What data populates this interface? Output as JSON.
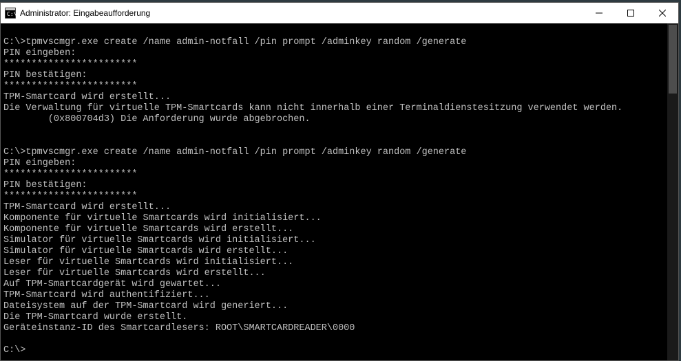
{
  "titlebar": {
    "title": "Administrator: Eingabeaufforderung"
  },
  "terminal": {
    "lines": [
      "",
      "C:\\>tpmvscmgr.exe create /name admin-notfall /pin prompt /adminkey random /generate",
      "PIN eingeben:",
      "************************",
      "PIN bestätigen:",
      "************************",
      "TPM-Smartcard wird erstellt...",
      "Die Verwaltung für virtuelle TPM-Smartcards kann nicht innerhalb einer Terminaldienstesitzung verwendet werden.",
      "        (0x800704d3) Die Anforderung wurde abgebrochen.",
      "",
      "",
      "C:\\>tpmvscmgr.exe create /name admin-notfall /pin prompt /adminkey random /generate",
      "PIN eingeben:",
      "************************",
      "PIN bestätigen:",
      "************************",
      "TPM-Smartcard wird erstellt...",
      "Komponente für virtuelle Smartcards wird initialisiert...",
      "Komponente für virtuelle Smartcards wird erstellt...",
      "Simulator für virtuelle Smartcards wird initialisiert...",
      "Simulator für virtuelle Smartcards wird erstellt...",
      "Leser für virtuelle Smartcards wird initialisiert...",
      "Leser für virtuelle Smartcards wird erstellt...",
      "Auf TPM-Smartcardgerät wird gewartet...",
      "TPM-Smartcard wird authentifiziert...",
      "Dateisystem auf der TPM-Smartcard wird generiert...",
      "Die TPM-Smartcard wurde erstellt.",
      "Geräteinstanz-ID des Smartcardlesers: ROOT\\SMARTCARDREADER\\0000",
      "",
      "C:\\>"
    ]
  }
}
